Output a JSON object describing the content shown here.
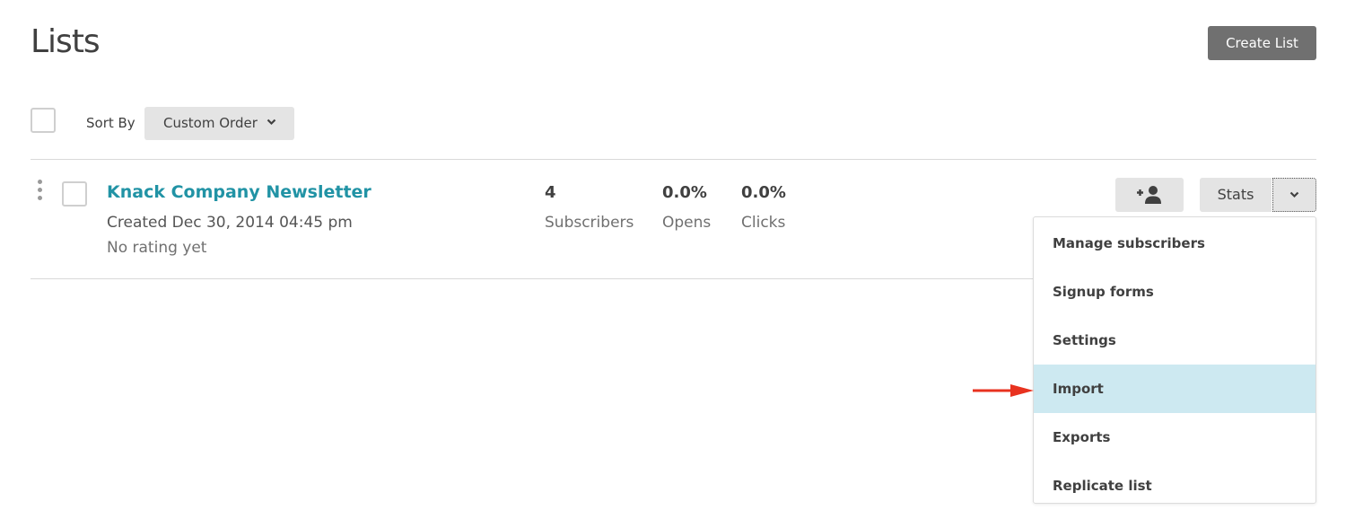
{
  "header": {
    "title": "Lists",
    "create_button_label": "Create List"
  },
  "toolbar": {
    "sort_by_label": "Sort By",
    "sort_value": "Custom Order"
  },
  "list_row": {
    "name": "Knack Company Newsletter",
    "created": "Created Dec 30, 2014 04:45 pm",
    "rating": "No rating yet",
    "stats": [
      {
        "value": "4",
        "label": "Subscribers"
      },
      {
        "value": "0.0%",
        "label": "Opens"
      },
      {
        "value": "0.0%",
        "label": "Clicks"
      }
    ],
    "stats_button_label": "Stats",
    "add_subscriber_icon": "add-user-icon"
  },
  "dropdown_menu": {
    "items": [
      {
        "label": "Manage subscribers",
        "active": false
      },
      {
        "label": "Signup forms",
        "active": false
      },
      {
        "label": "Settings",
        "active": false
      },
      {
        "label": "Import",
        "active": true
      },
      {
        "label": "Exports",
        "active": false
      },
      {
        "label": "Replicate list",
        "active": false
      }
    ]
  },
  "colors": {
    "link": "#2193a5",
    "primary_button": "#707070",
    "highlight": "#cde9f1",
    "annotation_arrow": "#e8321f"
  }
}
